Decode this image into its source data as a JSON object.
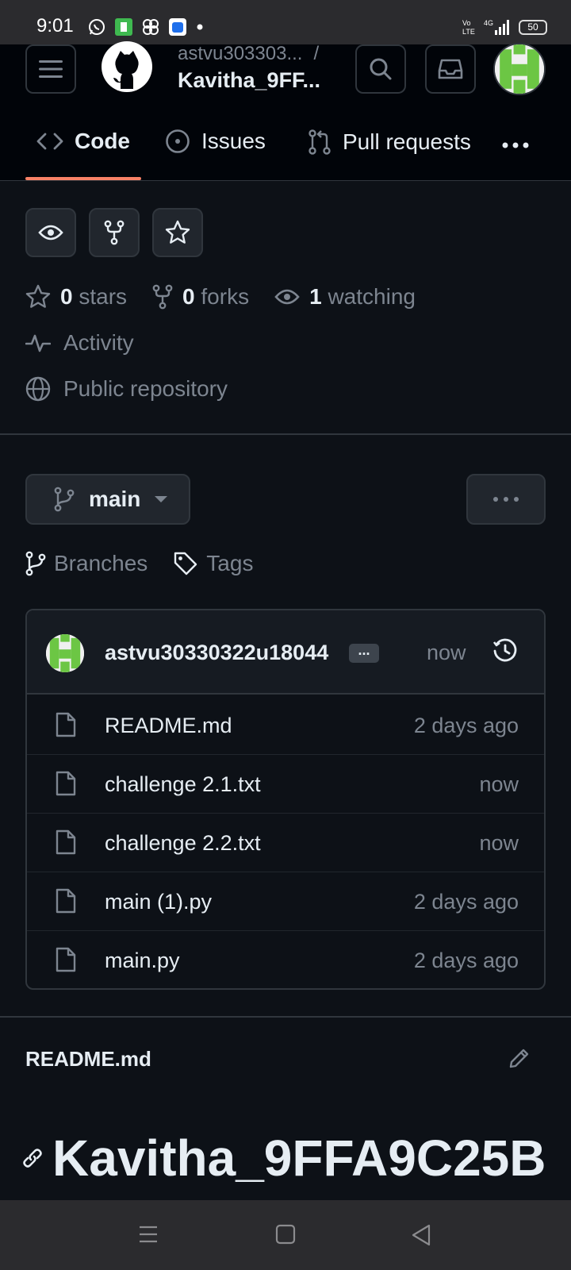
{
  "status_bar": {
    "time": "9:01",
    "network": "4G",
    "battery": "50"
  },
  "header": {
    "owner": "astvu303303...",
    "separator": "/",
    "repo_name": "Kavitha_9FF..."
  },
  "tabs": [
    {
      "label": "Code",
      "icon": "code-icon",
      "active": true
    },
    {
      "label": "Issues",
      "icon": "issue-opened-icon",
      "active": false
    },
    {
      "label": "Pull requests",
      "icon": "git-pull-request-icon",
      "active": false
    }
  ],
  "stats": {
    "stars_count": "0",
    "stars_label": "stars",
    "forks_count": "0",
    "forks_label": "forks",
    "watching_count": "1",
    "watching_label": "watching"
  },
  "activity_label": "Activity",
  "visibility_label": "Public repository",
  "branch": {
    "name": "main"
  },
  "branches_label": "Branches",
  "tags_label": "Tags",
  "latest_commit": {
    "author": "astvu30330322u18044",
    "badge": "...",
    "time": "now"
  },
  "files": [
    {
      "name": "README.md",
      "time": "2 days ago"
    },
    {
      "name": "challenge 2.1.txt",
      "time": "now"
    },
    {
      "name": "challenge 2.2.txt",
      "time": "now"
    },
    {
      "name": "main (1).py",
      "time": "2 days ago"
    },
    {
      "name": "main.py",
      "time": "2 days ago"
    }
  ],
  "readme": {
    "filename": "README.md",
    "title": "Kavitha_9FFA9C25B"
  },
  "colors": {
    "background": "#0d1117",
    "header": "#010409",
    "border": "#30363d",
    "muted_text": "#7d8590",
    "active_tab_underline": "#f78166",
    "avatar_green": "#6cc644"
  }
}
